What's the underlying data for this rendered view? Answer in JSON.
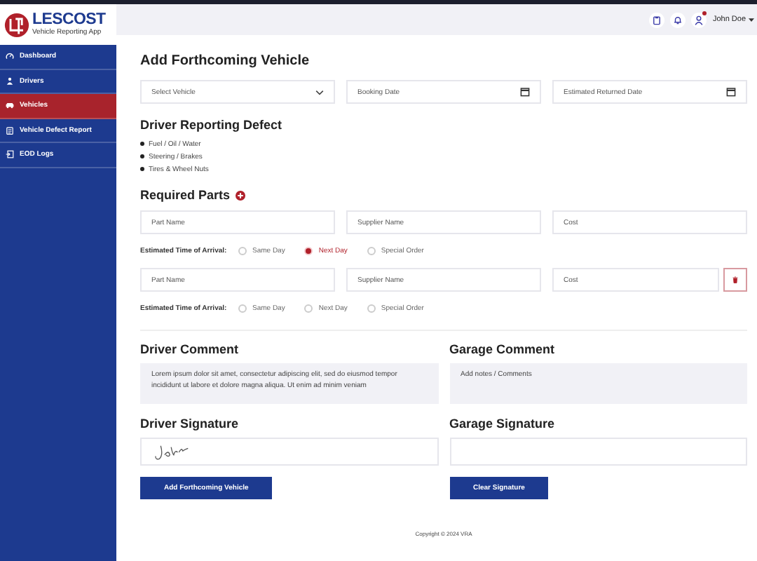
{
  "logo": {
    "name": "LESCOST",
    "tagline": "Vehicle Reporting App"
  },
  "sidebar": {
    "items": [
      {
        "label": "Dashboard",
        "selected": false
      },
      {
        "label": "Drivers",
        "selected": false
      },
      {
        "label": "Vehicles",
        "selected": true
      },
      {
        "label": "Vehicle Defect Report",
        "selected": false
      },
      {
        "label": "EOD Logs",
        "selected": false
      }
    ]
  },
  "header": {
    "user": "John Doe",
    "notification": true
  },
  "title": "Add Forthcoming Vehicle",
  "vehicle_fields": [
    {
      "kind": "select",
      "placeholder": "Select Vehicle"
    },
    {
      "kind": "date",
      "placeholder": "Booking Date"
    },
    {
      "kind": "date",
      "placeholder": "Estimated Returned Date"
    }
  ],
  "defects": {
    "title": "Driver Reporting Defect",
    "items": [
      "Fuel / Oil / Water",
      "Steering / Brakes",
      "Tires & Wheel Nuts"
    ]
  },
  "parts": {
    "title": "Required Parts",
    "rows": [
      {
        "part_name": "Part Name",
        "supplier_name": "Supplier Name",
        "cost": "Cost",
        "removable": false,
        "eta_label": "Estimated Time of Arrival:",
        "eta_options": [
          {
            "label": "Same Day",
            "selected": false
          },
          {
            "label": "Next Day",
            "selected": true
          },
          {
            "label": "Special Order",
            "selected": false
          }
        ]
      },
      {
        "part_name": "Part Name",
        "supplier_name": "Supplier Name",
        "cost": "Cost",
        "removable": true,
        "eta_label": "Estimated Time of Arrival:",
        "eta_options": [
          {
            "label": "Same Day",
            "selected": false
          },
          {
            "label": "Next Day",
            "selected": false
          },
          {
            "label": "Special Order",
            "selected": false
          }
        ]
      }
    ]
  },
  "driver_comment": {
    "title": "Driver Comment",
    "value": "Lorem ipsum dolor sit amet, consectetur adipiscing elit, sed do eiusmod tempor incididunt ut labore et dolore magna aliqua. Ut enim ad minim veniam"
  },
  "garage_comment": {
    "title": "Garage Comment",
    "placeholder": "Add notes / Comments"
  },
  "driver_signature": {
    "title": "Driver Signature",
    "signed": true
  },
  "garage_signature": {
    "title": "Garage Signature",
    "signed": false
  },
  "add_button": "Add Forthcoming Vehicle",
  "clear_button": "Clear Signature",
  "copyright": "Copyright © 2024 VRA"
}
